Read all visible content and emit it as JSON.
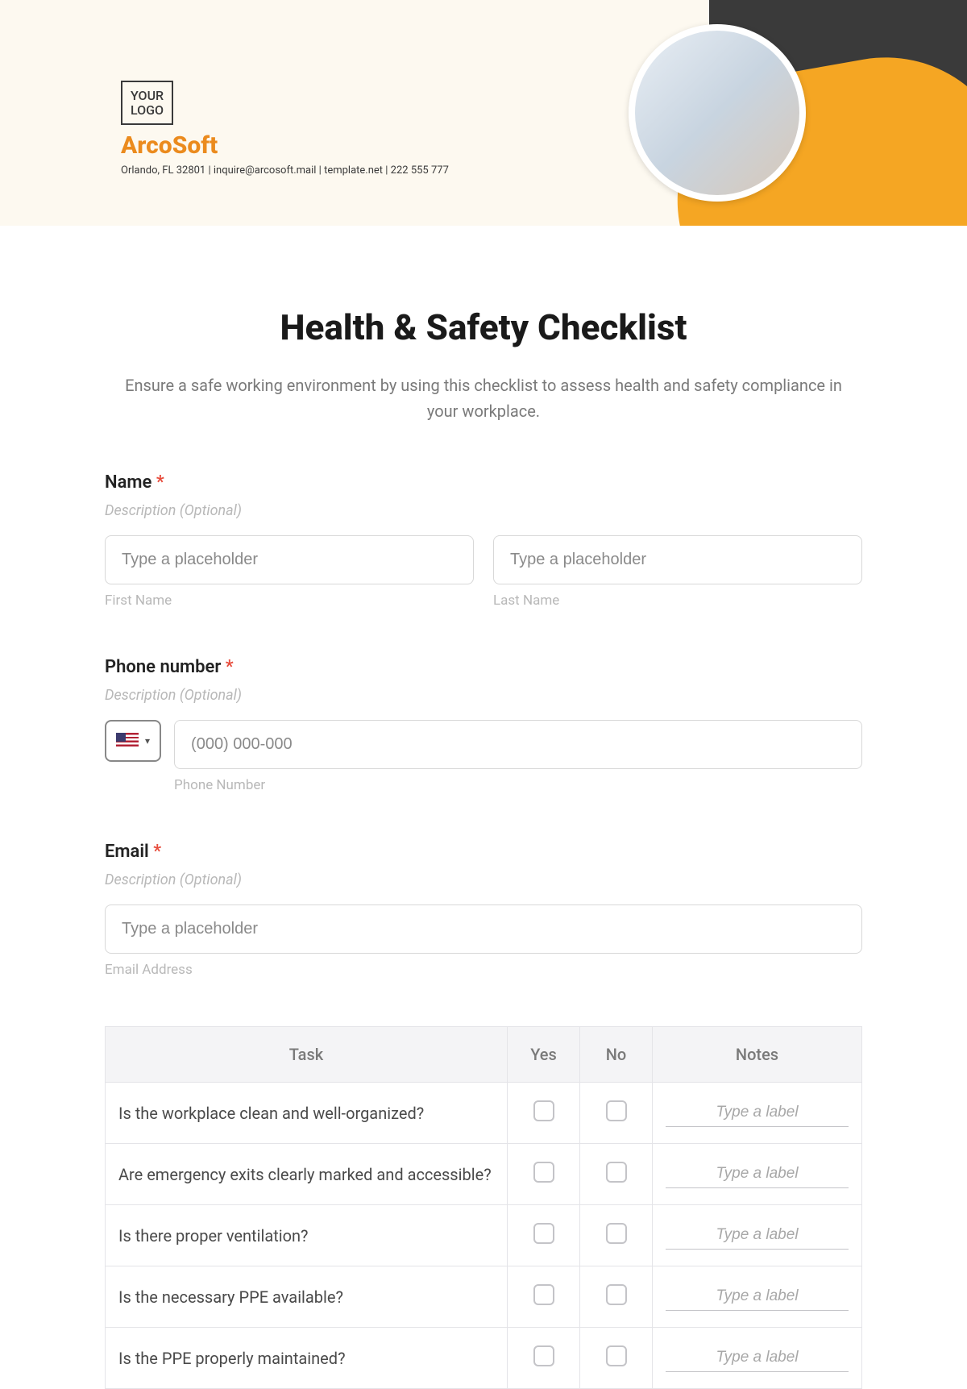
{
  "header": {
    "logo_line1": "YOUR",
    "logo_line2": "LOGO",
    "brand": "ArcoSoft",
    "meta": "Orlando, FL 32801 | inquire@arcosoft.mail | template.net | 222 555 777",
    "stripe_colors": [
      "#d88a1f",
      "#f5a623",
      "#f6c15a",
      "#f6d88f"
    ]
  },
  "title": "Health & Safety Checklist",
  "subtitle": "Ensure a safe working environment by using this checklist to assess health and safety compliance in your workplace.",
  "fields": {
    "name": {
      "label": "Name",
      "required": "*",
      "desc": "Description (Optional)",
      "first_placeholder": "Type a placeholder",
      "first_sub": "First Name",
      "last_placeholder": "Type a placeholder",
      "last_sub": "Last Name"
    },
    "phone": {
      "label": "Phone number",
      "required": "*",
      "desc": "Description (Optional)",
      "placeholder": "(000) 000-000",
      "sub": "Phone Number"
    },
    "email": {
      "label": "Email",
      "required": "*",
      "desc": "Description (Optional)",
      "placeholder": "Type a placeholder",
      "sub": "Email Address"
    }
  },
  "table": {
    "headers": {
      "task": "Task",
      "yes": "Yes",
      "no": "No",
      "notes": "Notes"
    },
    "note_placeholder": "Type a label",
    "rows": [
      {
        "task": "Is the workplace clean and well-organized?"
      },
      {
        "task": "Are emergency exits clearly marked and accessible?"
      },
      {
        "task": "Is there proper ventilation?"
      },
      {
        "task": "Is the necessary PPE available?"
      },
      {
        "task": "Is the PPE properly maintained?"
      }
    ]
  }
}
